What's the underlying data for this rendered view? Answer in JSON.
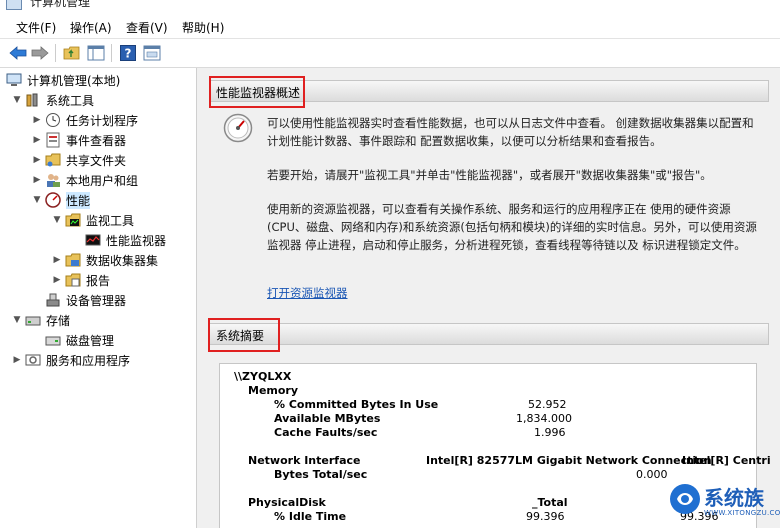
{
  "window": {
    "title": "计算机管理"
  },
  "menu": {
    "file": "文件(F)",
    "action": "操作(A)",
    "view": "查看(V)",
    "help": "帮助(H)"
  },
  "toolbar": {
    "icons": [
      "back-icon",
      "forward-icon",
      "up-folder-icon",
      "show-hide-tree-icon",
      "help-icon",
      "console-icon"
    ]
  },
  "tree": {
    "root": "计算机管理(本地)",
    "system_tools": "系统工具",
    "task_scheduler": "任务计划程序",
    "event_viewer": "事件查看器",
    "shared_folders": "共享文件夹",
    "local_users": "本地用户和组",
    "performance": "性能",
    "monitoring_tools": "监视工具",
    "perf_monitor": "性能监视器",
    "data_collector": "数据收集器集",
    "reports": "报告",
    "device_manager": "设备管理器",
    "storage": "存储",
    "disk_management": "磁盘管理",
    "services_apps": "服务和应用程序"
  },
  "overview": {
    "header": "性能监视器概述",
    "para1": "可以使用性能监视器实时查看性能数据，也可以从日志文件中查看。 创建数据收集器集以配置和计划性能计数器、事件跟踪和 配置数据收集，以便可以分析结果和查看报告。",
    "para2": "若要开始，请展开\"监视工具\"并单击\"性能监视器\"，或者展开\"数据收集器集\"或\"报告\"。",
    "para3": "使用新的资源监视器，可以查看有关操作系统、服务和运行的应用程序正在 使用的硬件资源(CPU、磁盘、网络和内存)和系统资源(包括句柄和模块)的详细的实时信息。另外，可以使用资源监视器 停止进程，启动和停止服务，分析进程死锁，查看线程等待链以及 标识进程锁定文件。",
    "link": "打开资源监视器"
  },
  "summary": {
    "header": "系统摘要",
    "host": "\\\\ZYQLXX",
    "memory": "Memory",
    "committed": "% Committed Bytes In Use",
    "committed_val": "52.952",
    "available": "Available MBytes",
    "available_val": "1,834.000",
    "cache": "Cache Faults/sec",
    "cache_val": "1.996",
    "netif": "Network Interface",
    "nic1": "Intel[R] 82577LM Gigabit Network Connection",
    "nic2": "Intel[R] Centri",
    "bytes_total": "Bytes Total/sec",
    "bytes_val2": "0.000",
    "physdisk": "PhysicalDisk",
    "total": "_Total",
    "idle": "% Idle Time",
    "idle_val": "99.396",
    "idle_val2": "99.396"
  },
  "watermark": {
    "text": "系统族",
    "url": "WWW.XITONGZU.COM"
  }
}
